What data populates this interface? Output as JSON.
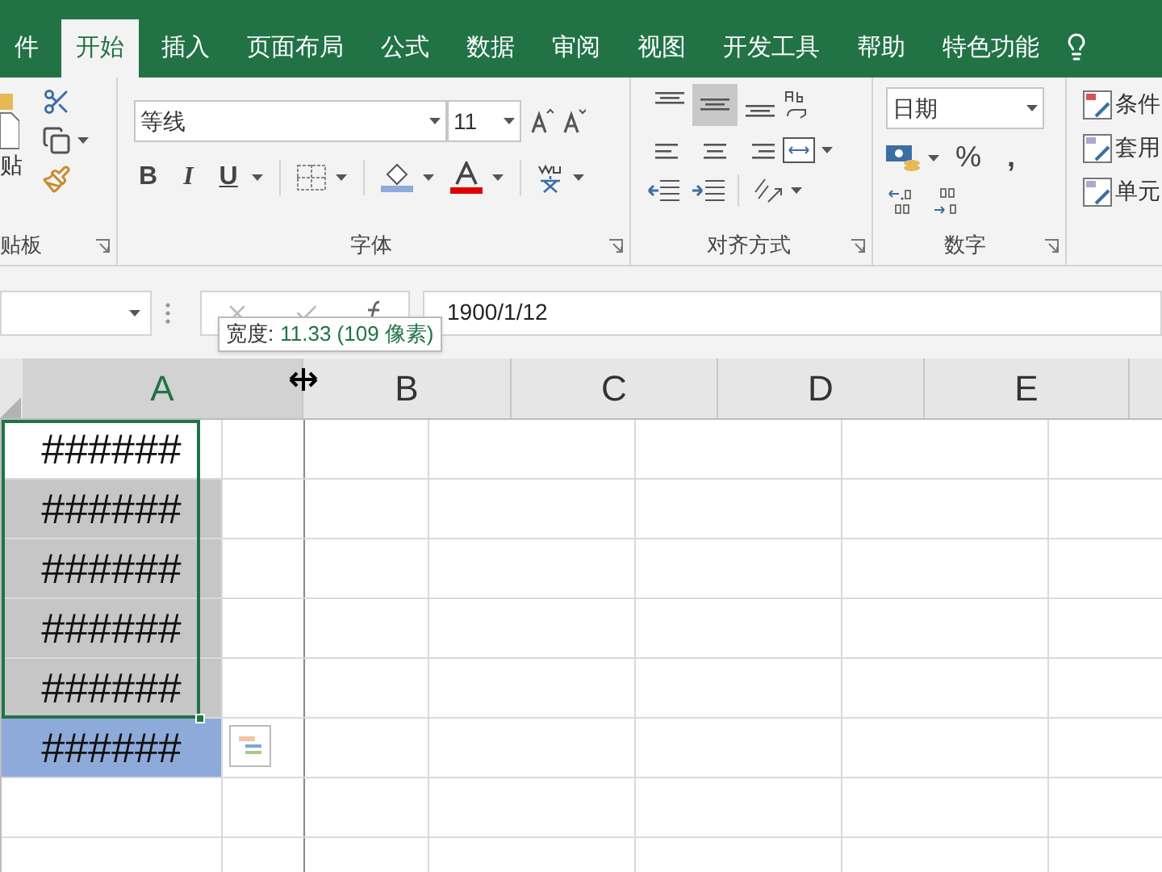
{
  "tabs": [
    {
      "label": "件",
      "selected": false
    },
    {
      "label": "开始",
      "selected": true
    },
    {
      "label": "插入",
      "selected": false
    },
    {
      "label": "页面布局",
      "selected": false
    },
    {
      "label": "公式",
      "selected": false
    },
    {
      "label": "数据",
      "selected": false
    },
    {
      "label": "审阅",
      "selected": false
    },
    {
      "label": "视图",
      "selected": false
    },
    {
      "label": "开发工具",
      "selected": false
    },
    {
      "label": "帮助",
      "selected": false
    },
    {
      "label": "特色功能",
      "selected": false
    }
  ],
  "ribbon": {
    "clipboard": {
      "paste_label": "贴",
      "group_label": "贴板"
    },
    "font": {
      "font_name": "等线",
      "font_size": "11",
      "bold": "B",
      "italic": "I",
      "underline": "U",
      "group_label": "字体"
    },
    "alignment": {
      "vertical_align": [
        {
          "selected": false
        },
        {
          "selected": true
        },
        {
          "selected": false
        }
      ],
      "group_label": "对齐方式"
    },
    "number": {
      "format": "日期",
      "percent": "%",
      "comma": ",",
      "group_label": "数字"
    },
    "styles": [
      "条件",
      "套用",
      "单元"
    ]
  },
  "formula_bar": {
    "value": "1900/1/12"
  },
  "tooltip": {
    "label": "宽度:",
    "value": "11.33 (109 像素)"
  },
  "columns": [
    "A",
    "B",
    "C",
    "D",
    "E"
  ],
  "cells": [
    {
      "text": "######",
      "kind": "active"
    },
    {
      "text": "######",
      "kind": "selected"
    },
    {
      "text": "######",
      "kind": "selected"
    },
    {
      "text": "######",
      "kind": "selected"
    },
    {
      "text": "######",
      "kind": "selected"
    },
    {
      "text": "######",
      "kind": "highlighted"
    }
  ]
}
